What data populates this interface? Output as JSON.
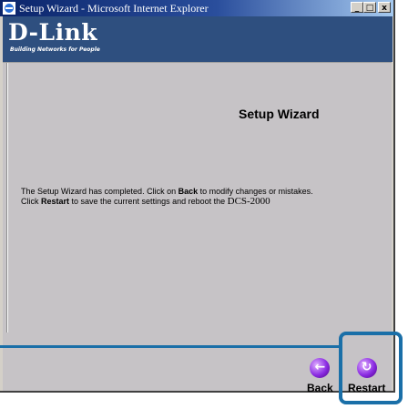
{
  "window": {
    "title": "Setup Wizard - Microsoft Internet Explorer",
    "minimize": "_",
    "maximize": "□",
    "close": "x"
  },
  "banner": {
    "logo": "D-Link",
    "tagline": "Building Networks for People"
  },
  "page": {
    "heading": "Setup Wizard",
    "message": {
      "line1_pre": "The Setup Wizard has completed. Click on ",
      "line1_bold": "Back",
      "line1_post": " to modify changes or mistakes.",
      "line2_pre": "Click ",
      "line2_bold": "Restart",
      "line2_mid": " to save the current settings and reboot the ",
      "line2_device": "DCS-2000"
    }
  },
  "actions": {
    "back_label": "Back",
    "restart_label": "Restart",
    "back_icon": "back-arrow-icon",
    "restart_icon": "restart-icon"
  },
  "colors": {
    "highlight": "#1a6fa8",
    "banner": "#2e4f7f",
    "page_bg": "#c6c3c6"
  }
}
